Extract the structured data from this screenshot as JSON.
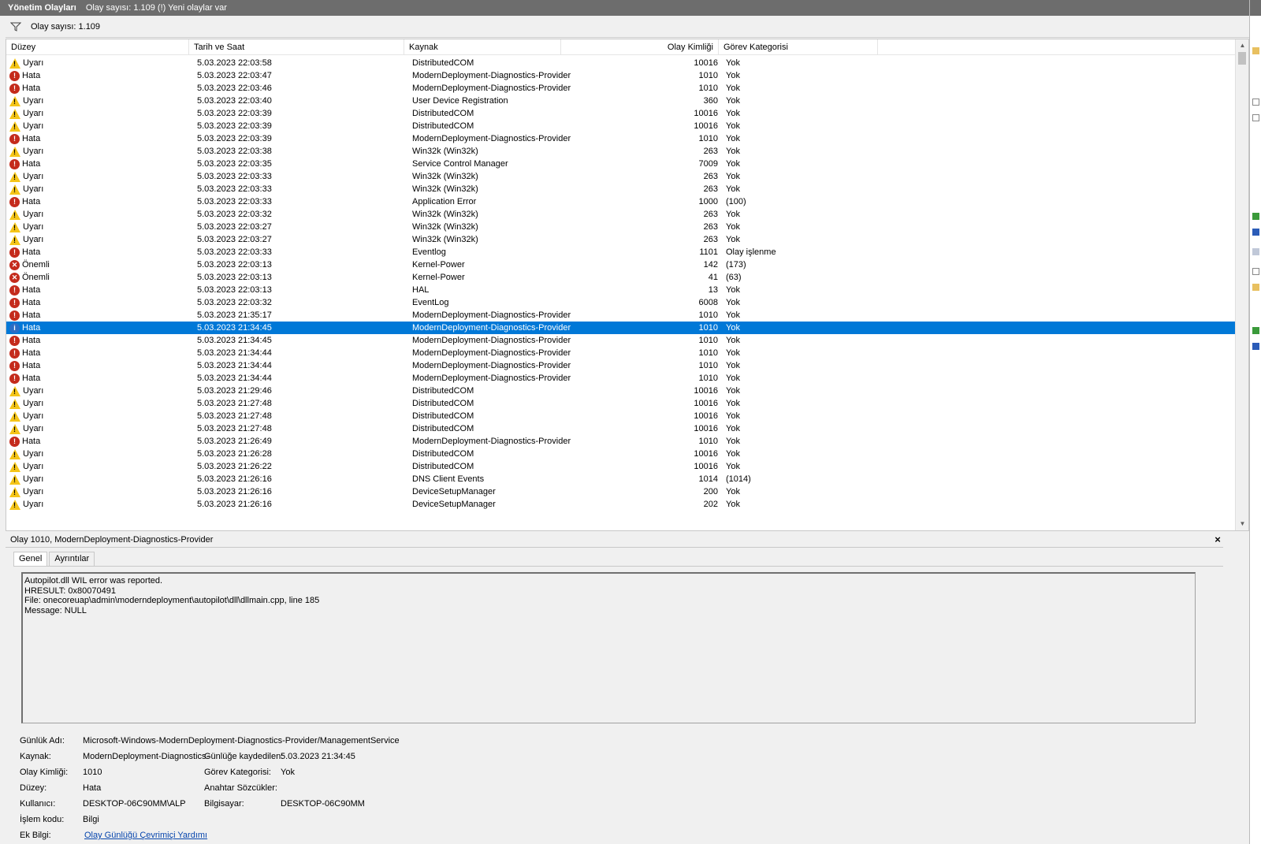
{
  "titlebar": {
    "title": "Yönetim Olayları",
    "subtitle": "Olay sayısı: 1.109 (!) Yeni olaylar var"
  },
  "filter": {
    "label": "Olay sayısı: 1.109"
  },
  "columns": {
    "level": "Düzey",
    "date": "Tarih ve Saat",
    "source": "Kaynak",
    "id": "Olay Kimliği",
    "category": "Görev Kategorisi"
  },
  "rows": [
    {
      "level": "Uyarı",
      "type": "warn",
      "date": "5.03.2023 22:03:58",
      "source": "DistributedCOM",
      "id": "10016",
      "cat": "Yok"
    },
    {
      "level": "Hata",
      "type": "err",
      "date": "5.03.2023 22:03:47",
      "source": "ModernDeployment-Diagnostics-Provider",
      "id": "1010",
      "cat": "Yok"
    },
    {
      "level": "Hata",
      "type": "err",
      "date": "5.03.2023 22:03:46",
      "source": "ModernDeployment-Diagnostics-Provider",
      "id": "1010",
      "cat": "Yok"
    },
    {
      "level": "Uyarı",
      "type": "warn",
      "date": "5.03.2023 22:03:40",
      "source": "User Device Registration",
      "id": "360",
      "cat": "Yok"
    },
    {
      "level": "Uyarı",
      "type": "warn",
      "date": "5.03.2023 22:03:39",
      "source": "DistributedCOM",
      "id": "10016",
      "cat": "Yok"
    },
    {
      "level": "Uyarı",
      "type": "warn",
      "date": "5.03.2023 22:03:39",
      "source": "DistributedCOM",
      "id": "10016",
      "cat": "Yok"
    },
    {
      "level": "Hata",
      "type": "err",
      "date": "5.03.2023 22:03:39",
      "source": "ModernDeployment-Diagnostics-Provider",
      "id": "1010",
      "cat": "Yok"
    },
    {
      "level": "Uyarı",
      "type": "warn",
      "date": "5.03.2023 22:03:38",
      "source": "Win32k (Win32k)",
      "id": "263",
      "cat": "Yok"
    },
    {
      "level": "Hata",
      "type": "err",
      "date": "5.03.2023 22:03:35",
      "source": "Service Control Manager",
      "id": "7009",
      "cat": "Yok"
    },
    {
      "level": "Uyarı",
      "type": "warn",
      "date": "5.03.2023 22:03:33",
      "source": "Win32k (Win32k)",
      "id": "263",
      "cat": "Yok"
    },
    {
      "level": "Uyarı",
      "type": "warn",
      "date": "5.03.2023 22:03:33",
      "source": "Win32k (Win32k)",
      "id": "263",
      "cat": "Yok"
    },
    {
      "level": "Hata",
      "type": "err",
      "date": "5.03.2023 22:03:33",
      "source": "Application Error",
      "id": "1000",
      "cat": "(100)"
    },
    {
      "level": "Uyarı",
      "type": "warn",
      "date": "5.03.2023 22:03:32",
      "source": "Win32k (Win32k)",
      "id": "263",
      "cat": "Yok"
    },
    {
      "level": "Uyarı",
      "type": "warn",
      "date": "5.03.2023 22:03:27",
      "source": "Win32k (Win32k)",
      "id": "263",
      "cat": "Yok"
    },
    {
      "level": "Uyarı",
      "type": "warn",
      "date": "5.03.2023 22:03:27",
      "source": "Win32k (Win32k)",
      "id": "263",
      "cat": "Yok"
    },
    {
      "level": "Hata",
      "type": "err",
      "date": "5.03.2023 22:03:33",
      "source": "Eventlog",
      "id": "1101",
      "cat": "Olay işlenme"
    },
    {
      "level": "Önemli",
      "type": "crit",
      "date": "5.03.2023 22:03:13",
      "source": "Kernel-Power",
      "id": "142",
      "cat": "(173)"
    },
    {
      "level": "Önemli",
      "type": "crit",
      "date": "5.03.2023 22:03:13",
      "source": "Kernel-Power",
      "id": "41",
      "cat": "(63)"
    },
    {
      "level": "Hata",
      "type": "err",
      "date": "5.03.2023 22:03:13",
      "source": "HAL",
      "id": "13",
      "cat": "Yok"
    },
    {
      "level": "Hata",
      "type": "err",
      "date": "5.03.2023 22:03:32",
      "source": "EventLog",
      "id": "6008",
      "cat": "Yok"
    },
    {
      "level": "Hata",
      "type": "err",
      "date": "5.03.2023 21:35:17",
      "source": "ModernDeployment-Diagnostics-Provider",
      "id": "1010",
      "cat": "Yok"
    },
    {
      "level": "Hata",
      "type": "info",
      "date": "5.03.2023 21:34:45",
      "source": "ModernDeployment-Diagnostics-Provider",
      "id": "1010",
      "cat": "Yok",
      "selected": true
    },
    {
      "level": "Hata",
      "type": "err",
      "date": "5.03.2023 21:34:45",
      "source": "ModernDeployment-Diagnostics-Provider",
      "id": "1010",
      "cat": "Yok"
    },
    {
      "level": "Hata",
      "type": "err",
      "date": "5.03.2023 21:34:44",
      "source": "ModernDeployment-Diagnostics-Provider",
      "id": "1010",
      "cat": "Yok"
    },
    {
      "level": "Hata",
      "type": "err",
      "date": "5.03.2023 21:34:44",
      "source": "ModernDeployment-Diagnostics-Provider",
      "id": "1010",
      "cat": "Yok"
    },
    {
      "level": "Hata",
      "type": "err",
      "date": "5.03.2023 21:34:44",
      "source": "ModernDeployment-Diagnostics-Provider",
      "id": "1010",
      "cat": "Yok"
    },
    {
      "level": "Uyarı",
      "type": "warn",
      "date": "5.03.2023 21:29:46",
      "source": "DistributedCOM",
      "id": "10016",
      "cat": "Yok"
    },
    {
      "level": "Uyarı",
      "type": "warn",
      "date": "5.03.2023 21:27:48",
      "source": "DistributedCOM",
      "id": "10016",
      "cat": "Yok"
    },
    {
      "level": "Uyarı",
      "type": "warn",
      "date": "5.03.2023 21:27:48",
      "source": "DistributedCOM",
      "id": "10016",
      "cat": "Yok"
    },
    {
      "level": "Uyarı",
      "type": "warn",
      "date": "5.03.2023 21:27:48",
      "source": "DistributedCOM",
      "id": "10016",
      "cat": "Yok"
    },
    {
      "level": "Hata",
      "type": "err",
      "date": "5.03.2023 21:26:49",
      "source": "ModernDeployment-Diagnostics-Provider",
      "id": "1010",
      "cat": "Yok"
    },
    {
      "level": "Uyarı",
      "type": "warn",
      "date": "5.03.2023 21:26:28",
      "source": "DistributedCOM",
      "id": "10016",
      "cat": "Yok"
    },
    {
      "level": "Uyarı",
      "type": "warn",
      "date": "5.03.2023 21:26:22",
      "source": "DistributedCOM",
      "id": "10016",
      "cat": "Yok"
    },
    {
      "level": "Uyarı",
      "type": "warn",
      "date": "5.03.2023 21:26:16",
      "source": "DNS Client Events",
      "id": "1014",
      "cat": "(1014)"
    },
    {
      "level": "Uyarı",
      "type": "warn",
      "date": "5.03.2023 21:26:16",
      "source": "DeviceSetupManager",
      "id": "200",
      "cat": "Yok"
    },
    {
      "level": "Uyarı",
      "type": "warn",
      "date": "5.03.2023 21:26:16",
      "source": "DeviceSetupManager",
      "id": "202",
      "cat": "Yok"
    }
  ],
  "details": {
    "title": "Olay 1010, ModernDeployment-Diagnostics-Provider",
    "close": "×",
    "tab_general": "Genel",
    "tab_details": "Ayrıntılar",
    "message": "Autopilot.dll WIL error was reported.\nHRESULT: 0x80070491\nFile: onecoreuap\\admin\\moderndeployment\\autopilot\\dll\\dllmain.cpp, line 185\nMessage: NULL",
    "log_name_label": "Günlük Adı:",
    "log_name": "Microsoft-Windows-ModernDeployment-Diagnostics-Provider/ManagementService",
    "source_label": "Kaynak:",
    "source": "ModernDeployment-Diagnostics-",
    "logged_label": "Günlüğe kaydedilen:",
    "logged": "5.03.2023 21:34:45",
    "event_id_label": "Olay Kimliği:",
    "event_id": "1010",
    "task_label": "Görev Kategorisi:",
    "task": "Yok",
    "level_label": "Düzey:",
    "level": "Hata",
    "keywords_label": "Anahtar Sözcükler:",
    "user_label": "Kullanıcı:",
    "user": "DESKTOP-06C90MM\\ALP",
    "computer_label": "Bilgisayar:",
    "computer": "DESKTOP-06C90MM",
    "opcode_label": "İşlem kodu:",
    "opcode": "Bilgi",
    "more_label": "Ek Bilgi:",
    "more_link": "Olay Günlüğü Çevrimiçi Yardımı"
  },
  "colors": {
    "selection": "#0078d7",
    "error": "#c42b1c",
    "warning": "#f5c518",
    "titlebar": "#6d6d6d"
  }
}
